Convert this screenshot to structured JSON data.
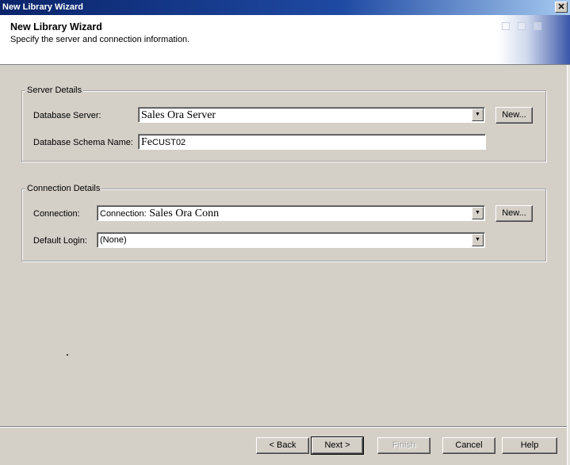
{
  "window": {
    "title": "New Library Wizard",
    "close_glyph": "✕"
  },
  "header": {
    "title": "New Library Wizard",
    "subtitle": "Specify the server and connection information."
  },
  "server_details": {
    "legend": "Server Details",
    "database_server": {
      "label": "Database Server:",
      "value": "Sales Ora Server",
      "new_button": "New..."
    },
    "schema_name": {
      "label": "Database Schema Name:",
      "value_large": "Fe",
      "value_small": "CUST02"
    }
  },
  "connection_details": {
    "legend": "Connection Details",
    "connection": {
      "label": "Connection:",
      "value_prefix": "Connection:",
      "value": "Sales Ora Conn",
      "new_button": "New..."
    },
    "default_login": {
      "label": "Default Login:",
      "value": "(None)"
    }
  },
  "footer": {
    "back": "< Back",
    "next": "Next >",
    "finish": "Finish",
    "cancel": "Cancel",
    "help": "Help"
  },
  "icons": {
    "dropdown": "chevron-down-icon",
    "close": "close-icon"
  }
}
